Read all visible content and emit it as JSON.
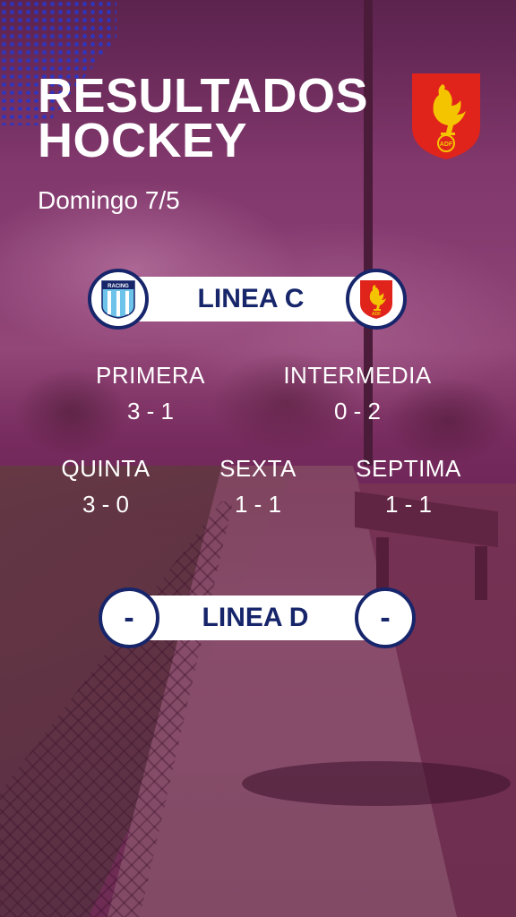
{
  "header": {
    "title_line1": "RESULTADOS",
    "title_line2": "HOCKEY",
    "date": "Domingo 7/5"
  },
  "club_logo": {
    "icon": "rooster-shield-icon",
    "text": "ADF",
    "color": "#e0241c"
  },
  "linea_c": {
    "label": "LINEA C",
    "opponent_logo": {
      "icon": "racing-club-icon",
      "text": "RACING"
    },
    "home_logo": {
      "icon": "rooster-shield-icon",
      "text": "ADF"
    },
    "results": [
      {
        "category": "PRIMERA",
        "score": "3 - 1"
      },
      {
        "category": "INTERMEDIA",
        "score": "0 - 2"
      },
      {
        "category": "QUINTA",
        "score": "3 - 0"
      },
      {
        "category": "SEXTA",
        "score": "1 - 1"
      },
      {
        "category": "SEPTIMA",
        "score": "1 - 1"
      }
    ]
  },
  "linea_d": {
    "label": "LINEA D",
    "left_placeholder": "-",
    "right_placeholder": "-"
  },
  "colors": {
    "navy": "#17256b",
    "white": "#ffffff",
    "red": "#e0241c",
    "gold": "#f5c400",
    "dots": "#2a36c8"
  }
}
